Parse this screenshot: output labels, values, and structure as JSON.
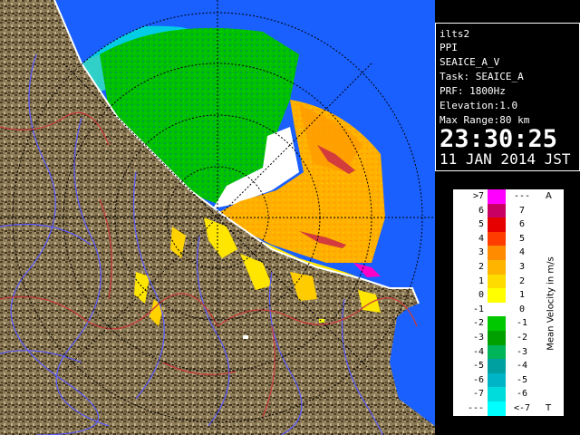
{
  "info_panel": {
    "station": "ilts2",
    "scan_mode": "PPI",
    "product": "SEAICE_A_V",
    "task": "Task: SEAICE_A",
    "prf": "PRF: 1800Hz",
    "elevation": "Elevation:1.0",
    "max_range": "Max Range:80 km",
    "time": "23:30:25",
    "date": "11 JAN 2014 JST"
  },
  "legend": {
    "title": "Mean Velocity in m/s",
    "corner_top": "A",
    "corner_bottom": "T",
    "rows": [
      {
        "left": ">7",
        "right": "---",
        "color": "#ff00ff"
      },
      {
        "left": "6",
        "right": "7",
        "color": "#c80064"
      },
      {
        "left": "5",
        "right": "6",
        "color": "#e60000"
      },
      {
        "left": "4",
        "right": "5",
        "color": "#ff3c00"
      },
      {
        "left": "3",
        "right": "4",
        "color": "#ff8c00"
      },
      {
        "left": "2",
        "right": "3",
        "color": "#ffb400"
      },
      {
        "left": "1",
        "right": "2",
        "color": "#ffdc00"
      },
      {
        "left": "0",
        "right": "1",
        "color": "#ffff00"
      },
      {
        "left": "-1",
        "right": "0",
        "color": "#ffffff"
      },
      {
        "left": "-2",
        "right": "-1",
        "color": "#00c800"
      },
      {
        "left": "-3",
        "right": "-2",
        "color": "#00a000"
      },
      {
        "left": "-4",
        "right": "-3",
        "color": "#00b45a"
      },
      {
        "left": "-5",
        "right": "-4",
        "color": "#00a0a0"
      },
      {
        "left": "-6",
        "right": "-5",
        "color": "#00b4c8"
      },
      {
        "left": "-7",
        "right": "-6",
        "color": "#00dcdc"
      },
      {
        "left": "---",
        "right": "<-7",
        "color": "#00ffff"
      }
    ]
  },
  "colors": {
    "ocean": "#1a60ff",
    "land": "#8b7a55",
    "coast": "#ffffff",
    "river": "#5a5aff",
    "border": "#c83c3c",
    "range_ring": "#000000"
  },
  "icons": [
    "radar-ppi-map"
  ]
}
